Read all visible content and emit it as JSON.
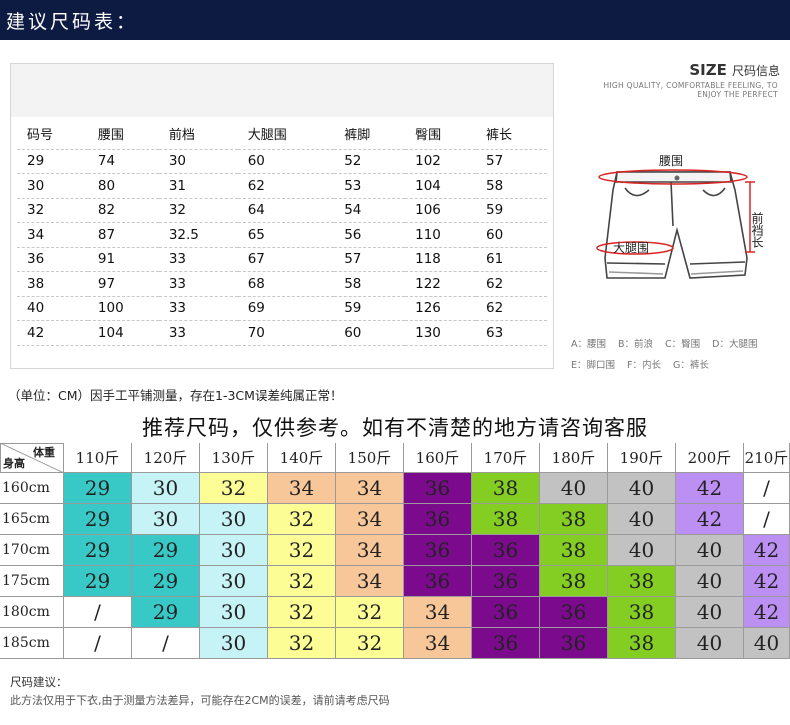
{
  "header": {
    "title": "建议尺码表："
  },
  "measure_table": {
    "columns": [
      "码号",
      "腰围",
      "前档",
      "大腿围",
      "裤脚",
      "臀围",
      "裤长"
    ],
    "rows": [
      [
        "29",
        "74",
        "30",
        "60",
        "52",
        "102",
        "57"
      ],
      [
        "30",
        "80",
        "31",
        "62",
        "53",
        "104",
        "58"
      ],
      [
        "32",
        "82",
        "32",
        "64",
        "54",
        "106",
        "59"
      ],
      [
        "34",
        "87",
        "32.5",
        "65",
        "56",
        "110",
        "60"
      ],
      [
        "36",
        "91",
        "33",
        "67",
        "57",
        "118",
        "61"
      ],
      [
        "38",
        "97",
        "33",
        "68",
        "58",
        "122",
        "62"
      ],
      [
        "40",
        "100",
        "33",
        "69",
        "59",
        "126",
        "62"
      ],
      [
        "42",
        "104",
        "33",
        "70",
        "60",
        "130",
        "63"
      ]
    ]
  },
  "size_info": {
    "size_word": "SIZE",
    "size_cn": "尺码信息",
    "sub_line1": "HIGH QUALITY, COMFORTABLE FEELING, TO",
    "sub_line2": "ENJOY THE PERFECT"
  },
  "diagram_labels": {
    "waist": "腰围",
    "front_rise": "前裆长",
    "thigh": "大腿围"
  },
  "legend": {
    "row1": [
      "A：腰围",
      "B：前浪",
      "C：臀围",
      "D：大腿围"
    ],
    "row2": [
      "E：脚口围",
      "F：内长",
      "G：裤长"
    ]
  },
  "unit_note": "（单位：CM）因手工平铺测量，存在1-3CM误差纯属正常！",
  "recommend": {
    "title": "推荐尺码，仅供参考。如有不清楚的地方请咨询客服",
    "corner_weight": "体重",
    "corner_height": "身高",
    "weights": [
      "110斤",
      "120斤",
      "130斤",
      "140斤",
      "150斤",
      "160斤",
      "170斤",
      "180斤",
      "190斤",
      "200斤",
      "210斤"
    ],
    "heights": [
      "160cm",
      "165cm",
      "170cm",
      "175cm",
      "180cm",
      "185cm"
    ],
    "cells": [
      [
        "29",
        "30",
        "32",
        "34",
        "34",
        "36",
        "38",
        "40",
        "40",
        "42",
        "/"
      ],
      [
        "29",
        "30",
        "30",
        "32",
        "34",
        "36",
        "38",
        "38",
        "40",
        "42",
        "/"
      ],
      [
        "29",
        "29",
        "30",
        "32",
        "34",
        "36",
        "36",
        "38",
        "40",
        "40",
        "42"
      ],
      [
        "29",
        "29",
        "30",
        "32",
        "34",
        "36",
        "36",
        "38",
        "38",
        "40",
        "42"
      ],
      [
        "/",
        "29",
        "30",
        "32",
        "32",
        "34",
        "36",
        "36",
        "38",
        "40",
        "42"
      ],
      [
        "/",
        "/",
        "30",
        "32",
        "32",
        "34",
        "36",
        "36",
        "38",
        "40",
        "40"
      ]
    ],
    "size_colors": {
      "29": "#38c9c6",
      "30": "#c6f3f6",
      "32": "#fdfd95",
      "34": "#f7c799",
      "36": "#7b0a8c",
      "38": "#84cd22",
      "40": "#c2c2c2",
      "42": "#bc8ff2",
      "/": "#ffffff"
    }
  },
  "advice": {
    "title": "尺码建议：",
    "text": "此方法仅用于下衣,由于测量方法差异，可能存在2CM的误差，请前请考虑尺码"
  }
}
